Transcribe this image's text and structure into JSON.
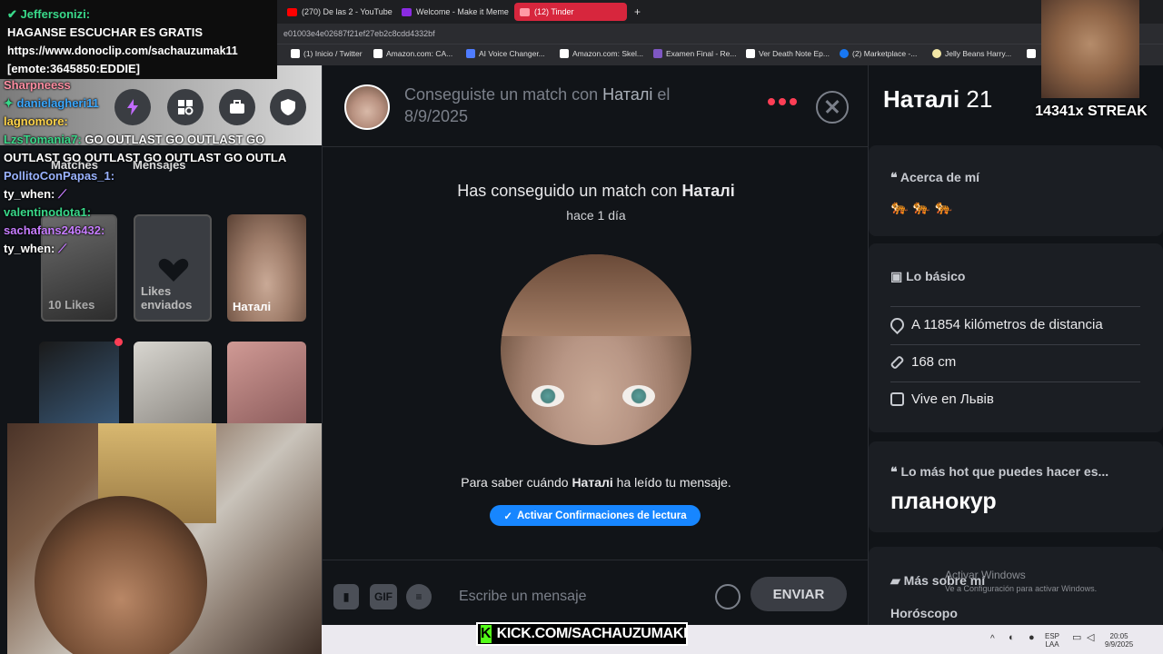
{
  "browser": {
    "tabs": [
      {
        "label": "(270) De las 2 - YouTube",
        "color": "#ff0000"
      },
      {
        "label": "Welcome - Make it Meme",
        "color": "#8a2be2"
      },
      {
        "label": "(12) Tinder",
        "color": "#fd3e55",
        "active": true
      }
    ],
    "url": "e01003e4e02687f21ef27eb2c8cdd4332bf",
    "bookmarks": [
      {
        "label": "(1) Inicio / Twitter",
        "color": "#ffffff"
      },
      {
        "label": "Amazon.com: CA...",
        "color": "#ffffff"
      },
      {
        "label": "AI Voice Changer...",
        "color": "#4f7cff"
      },
      {
        "label": "Amazon.com: Skel...",
        "color": "#ffffff"
      },
      {
        "label": "Examen Final - Re...",
        "color": "#7e57c2"
      },
      {
        "label": "Ver Death Note Ep...",
        "color": "#ffffff"
      },
      {
        "label": "(2) Marketplace -...",
        "color": "#1877f2"
      },
      {
        "label": "Jelly Beans Harry...",
        "color": "#f2e6a6"
      }
    ]
  },
  "pinned": {
    "user": "Jeffersonizi:",
    "line1": "HAGANSE ESCUCHAR ES GRATIS",
    "line2": "https://www.donoclip.com/sachauzumak11",
    "line3": "[emote:3645850:EDDIE]"
  },
  "chat": [
    {
      "user": "Sharpneess",
      "color": "#ff8fa3",
      "msg": ""
    },
    {
      "user": "danielagheri11",
      "color": "#3aa8ff",
      "msg": ""
    },
    {
      "user": "lagnomore:",
      "color": "#ffd54a",
      "msg": ""
    },
    {
      "user": "LzsTomania7:",
      "color": "#39d98a",
      "msg": "GO OUTLAST GO OUTLAST GO"
    },
    {
      "user": "",
      "color": "#ffffff",
      "msg": "OUTLAST GO OUTLAST GO OUTLAST GO OUTLA"
    },
    {
      "user": "PollitoConPapas_1:",
      "color": "#9ab3ff",
      "msg": ""
    },
    {
      "user": "ty_when:",
      "color": "#ffffff",
      "msg": ""
    },
    {
      "user": "valentinodota1:",
      "color": "#39d98a",
      "msg": ""
    },
    {
      "user": "sachafans246432:",
      "color": "#c77dff",
      "msg": ""
    },
    {
      "user": "ty_when:",
      "color": "#ffffff",
      "msg": ""
    }
  ],
  "left": {
    "tab_matches": "Matches",
    "tab_messages": "Mensajes",
    "card_likes": "10 Likes",
    "card_sent_line1": "Likes",
    "card_sent_line2": "enviados",
    "card_match_name": "Наталі"
  },
  "match": {
    "header_prefix": "Conseguiste un match con",
    "name": "Наталі",
    "header_suffix": "el",
    "date": "8/9/2025",
    "title_prefix": "Has conseguido un match con",
    "time": "hace 1 día",
    "read_prefix": "Para saber cuándo",
    "read_suffix": "ha leído tu mensaje.",
    "read_button": "Activar Confirmaciones de lectura",
    "composer_placeholder": "Escribe un mensaje",
    "gif_label": "GIF",
    "send_label": "ENVIAR"
  },
  "profile": {
    "name": "Наталі",
    "age": "21",
    "about_title": "Acerca de mí",
    "about_emojis": "🐅 🐅 🐅",
    "basics_title": "Lo básico",
    "distance": "A 11854 kilómetros de distancia",
    "height": "168 cm",
    "lives": "Vive en Львів",
    "hot_title": "Lo más hot que puedes hacer es...",
    "hot_value": "планокур",
    "more_title": "Más sobre mí",
    "horoscope": "Horóscopo"
  },
  "overlay": {
    "streak": "14341x STREAK",
    "kick": "KICK.COM/SACHAUZUMAKI",
    "watermark_title": "Activar Windows",
    "watermark_sub": "Ve a Configuración para activar Windows."
  },
  "taskbar": {
    "lang1": "ESP",
    "lang2": "LAA",
    "time": "20:05",
    "date": "9/9/2025"
  },
  "colors": {
    "accent": "#fd3e55",
    "button_blue": "#1786ff",
    "kick_green": "#53fc18"
  }
}
